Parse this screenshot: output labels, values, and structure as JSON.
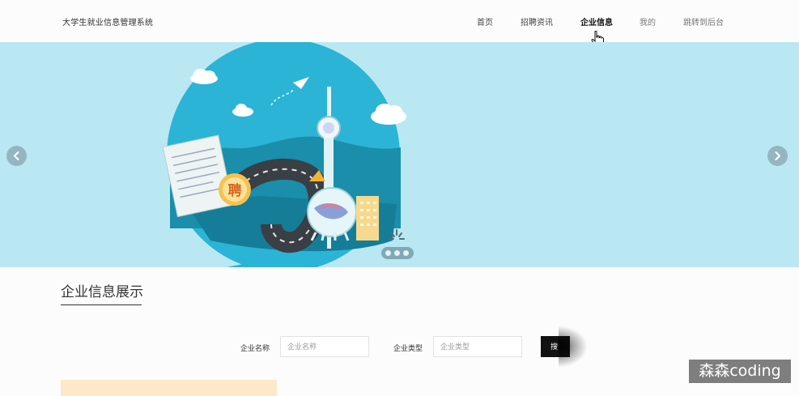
{
  "header": {
    "brand": "大学生就业信息管理系统",
    "nav": [
      {
        "label": "首页",
        "state": "normal"
      },
      {
        "label": "招聘资讯",
        "state": "normal"
      },
      {
        "label": "企业信息",
        "state": "active"
      },
      {
        "label": "我的",
        "state": "muted"
      },
      {
        "label": "跳转到后台",
        "state": "muted"
      }
    ]
  },
  "banner": {
    "image_badge_text": "聘",
    "slide_count": 3,
    "active_slide": 1,
    "prev_icon": "chevron-left-icon",
    "next_icon": "chevron-right-icon",
    "background_color": "#b9e8f3"
  },
  "section": {
    "title": "企业信息展示"
  },
  "search": {
    "name_label": "企业名称",
    "name_placeholder": "企业名称",
    "type_label": "企业类型",
    "type_placeholder": "企业类型",
    "button_label": "搜"
  },
  "watermark": "森森coding",
  "colors": {
    "accent": "#111111",
    "banner_circle": "#2bb4d6",
    "card_peek": "#fde9c9"
  }
}
